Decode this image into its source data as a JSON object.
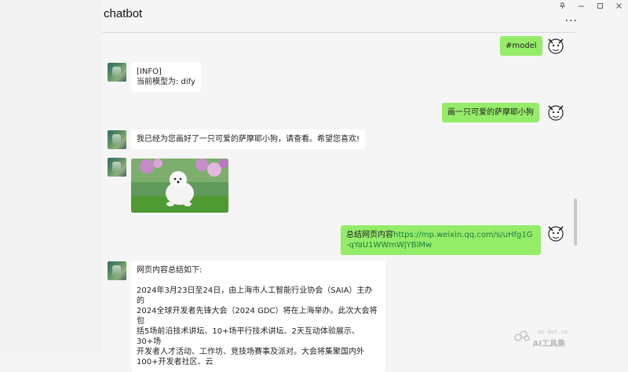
{
  "window": {
    "title": "chatbot",
    "controls": [
      "pin-icon",
      "minimize-icon",
      "maximize-icon",
      "close-icon"
    ],
    "more_label": "..."
  },
  "messages": [
    {
      "side": "right",
      "text": "#model"
    },
    {
      "side": "left",
      "lines": [
        "[INFO]",
        "当前模型为: dify"
      ]
    },
    {
      "side": "right",
      "text": "画一只可爱的萨摩耶小狗"
    },
    {
      "side": "left",
      "text": "我已经为您画好了一只可爱的萨摩耶小狗，请查看。希望您喜欢!"
    },
    {
      "side": "left",
      "image": "samoyed-dog-image"
    },
    {
      "side": "right",
      "prefix": "总结网页内容",
      "link": "https://mp.weixin.qq.com/s/uHfg1G-qYaU1WWmWjYBlMw"
    },
    {
      "side": "left",
      "lines": [
        "网页内容总结如下:",
        "",
        "2024年3月23日至24日，由上海市人工智能行业协会（SAIA）主办的",
        "2024全球开发者先锋大会（2024 GDC）将在上海举办。此次大会将包",
        "括5场前沿技术讲坛、10+场平行技术讲坛、2天互动体验展示、30+场",
        "开发者人才活动、工作坊、竞技场赛事及派对。大会将集聚国内外",
        "100+开发者社区、云"
      ]
    }
  ],
  "watermark": {
    "site": "ai-bot.cn",
    "name": "AI工具集"
  },
  "colors": {
    "sent_bubble": "#95ec69",
    "received_bubble": "#ffffff",
    "background": "#f5f5f5",
    "link": "#1d7d3c"
  }
}
